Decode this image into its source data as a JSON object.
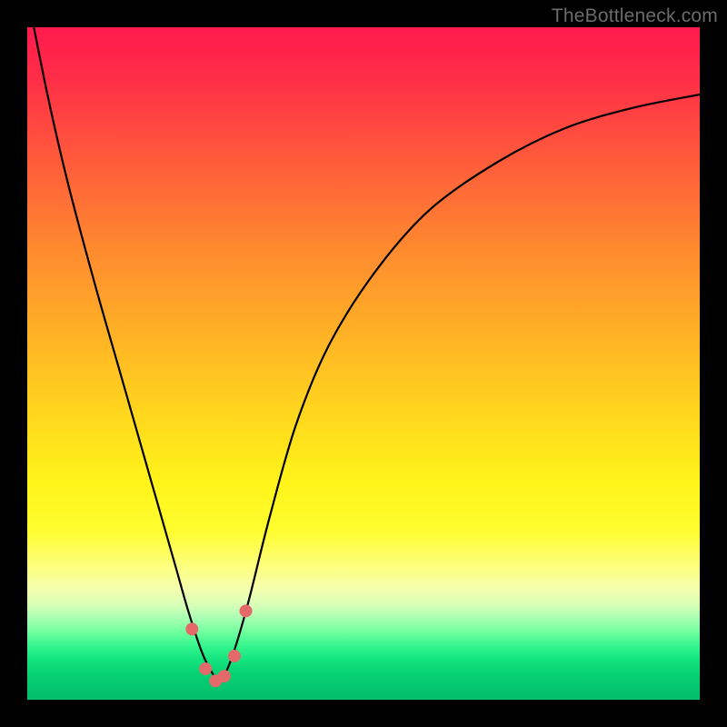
{
  "watermark": "TheBottleneck.com",
  "colors": {
    "frame": "#000000",
    "gradient_top": "#ff1a4d",
    "gradient_bottom": "#02c06c",
    "curve": "#000000",
    "markers": "#e46a6a"
  },
  "chart_data": {
    "type": "line",
    "title": "",
    "xlabel": "",
    "ylabel": "",
    "xlim": [
      0,
      100
    ],
    "ylim": [
      0,
      100
    ],
    "grid": false,
    "legend": false,
    "series": [
      {
        "name": "bottleneck-curve",
        "x": [
          0,
          3,
          6,
          10,
          14,
          18,
          22,
          24,
          26,
          27.5,
          28.5,
          29.5,
          31,
          33,
          36,
          40,
          45,
          52,
          60,
          70,
          80,
          90,
          100
        ],
        "y": [
          105,
          90,
          77,
          62,
          48,
          34,
          20,
          13,
          7,
          4,
          3,
          4,
          8,
          15,
          27,
          41,
          53,
          64,
          73,
          80,
          85,
          88,
          90
        ]
      }
    ],
    "markers": {
      "name": "valley-markers",
      "x": [
        24.5,
        26.5,
        28,
        29.3,
        30.8,
        32.5
      ],
      "y": [
        10.5,
        4.6,
        2.8,
        3.5,
        6.5,
        13.2
      ],
      "color": "#e46a6a",
      "radius_px": 7
    },
    "minimum": {
      "x": 28.5,
      "y": 3
    }
  }
}
